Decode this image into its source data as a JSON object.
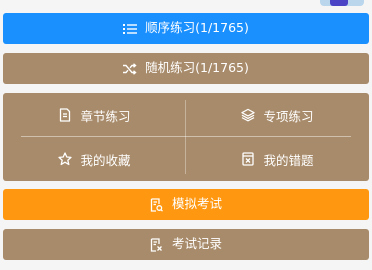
{
  "buttons": {
    "sequence_practice": "顺序练习(1/1765)",
    "random_practice": "随机练习(1/1765)",
    "mock_exam": "模拟考试",
    "exam_records": "考试记录"
  },
  "grid": {
    "chapter_practice": "章节练习",
    "special_practice": "专项练习",
    "my_favorites": "我的收藏",
    "my_mistakes": "我的错题"
  },
  "colors": {
    "primary_blue": "#1a90ff",
    "brown": "#a88b6a",
    "orange": "#ff9810",
    "background": "#f5f5f5"
  },
  "icons": {
    "sequence": "list-icon",
    "random": "shuffle-icon",
    "chapter": "document-icon",
    "special": "layers-icon",
    "favorites": "star-icon",
    "mistakes": "error-book-icon",
    "mock_exam": "exam-paper-icon",
    "records": "exam-record-icon"
  }
}
